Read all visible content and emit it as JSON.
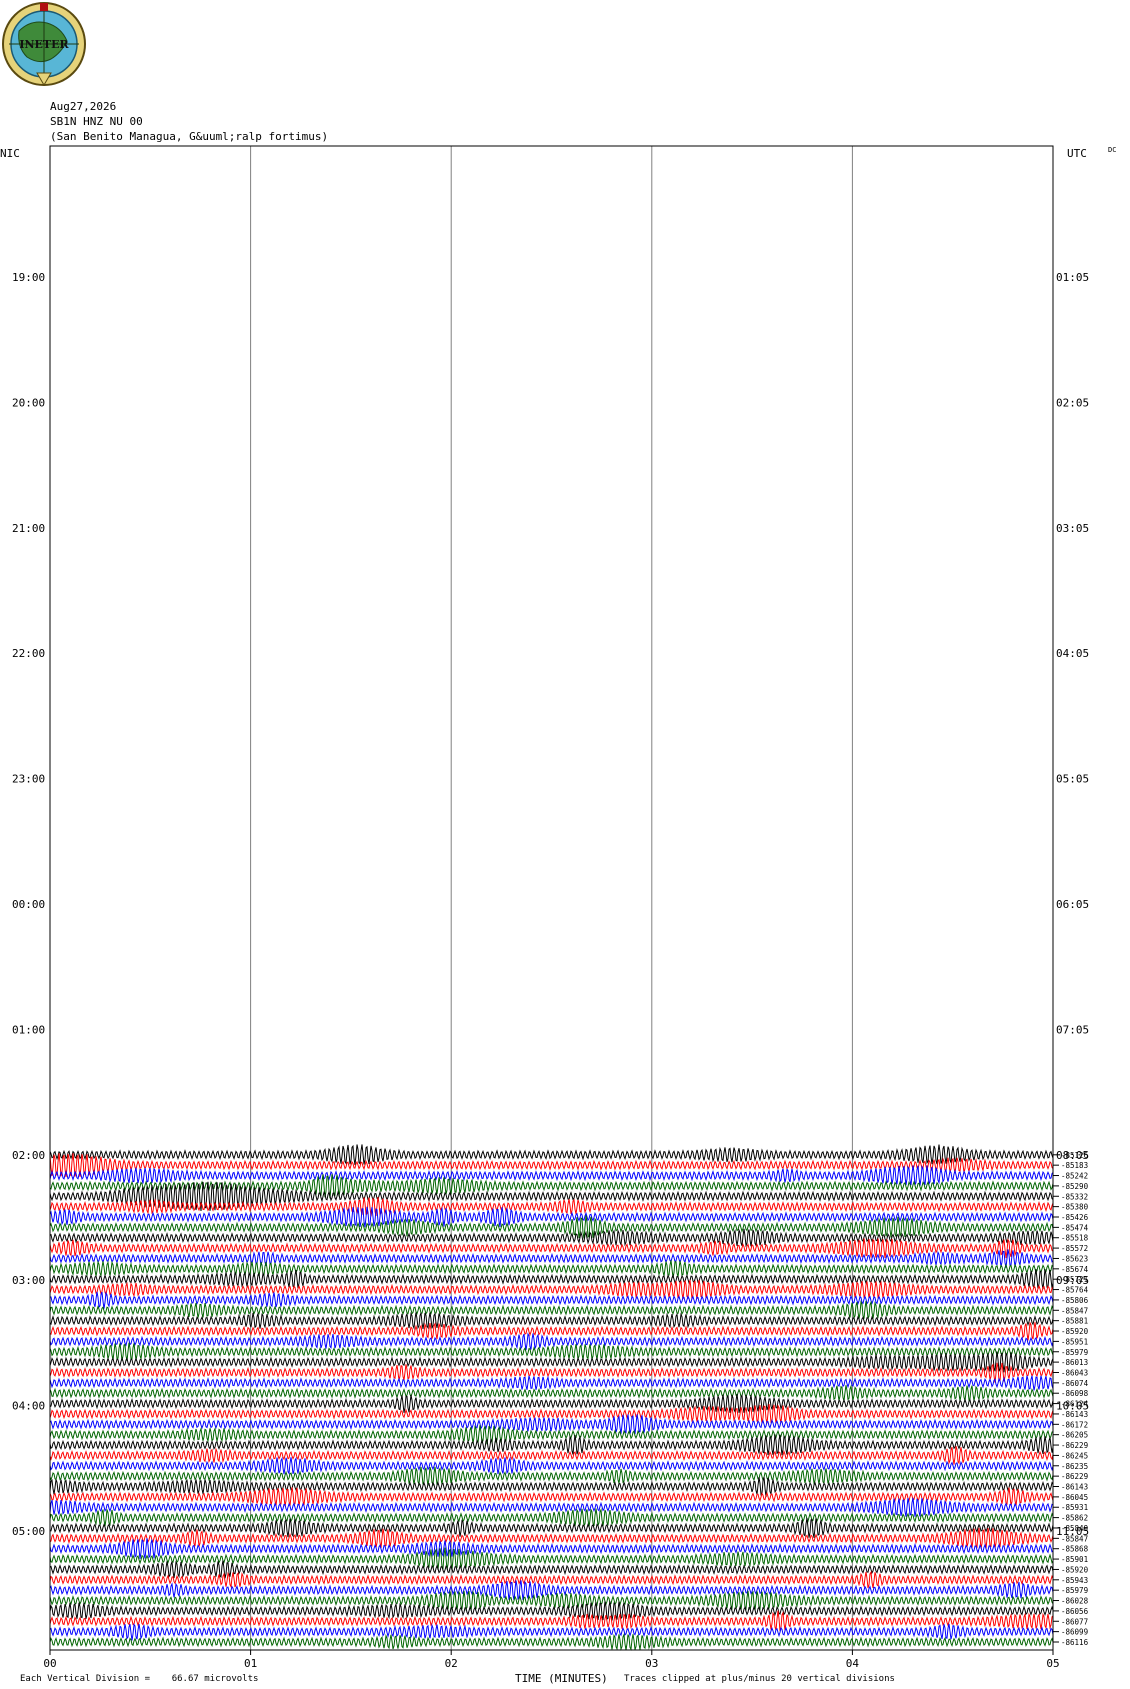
{
  "logo": {
    "text": "INETER"
  },
  "header": {
    "date": "Aug27,2026",
    "station": "SB1N HNZ NU 00",
    "location": "(San Benito Managua, G&uuml;ralp fortimus)"
  },
  "left_axis_title": "NIC",
  "right_axis_title": "UTC",
  "dc_label": "DC",
  "footer": {
    "scale": "Each Vertical Division =    66.67 microvolts",
    "xlabel": "TIME (MINUTES)",
    "clip_note": "Traces clipped at plus/minus 20 vertical divisions"
  },
  "colors": {
    "trace_cycle": [
      "#000000",
      "#ff0000",
      "#0000ff",
      "#006400"
    ],
    "grid": "#808080"
  },
  "chart_data": {
    "type": "line",
    "x_ticks": [
      "00",
      "01",
      "02",
      "03",
      "04",
      "05"
    ],
    "xlim": [
      0,
      5
    ],
    "left_time_labels": [
      "19:00",
      "20:00",
      "21:00",
      "22:00",
      "23:00",
      "00:00",
      "01:00",
      "02:00",
      "03:00",
      "04:00",
      "05:00"
    ],
    "right_time_labels": [
      "01:05",
      "02:05",
      "03:05",
      "04:05",
      "05:05",
      "06:05",
      "07:05",
      "08:05",
      "09:05",
      "10:05",
      "11:05"
    ],
    "trace_start_hour_index": 7,
    "trace_dc_offsets": [
      "-85126",
      "-85183",
      "-85242",
      "-85290",
      "-85332",
      "-85380",
      "-85426",
      "-85474",
      "-85518",
      "-85572",
      "-85623",
      "-85674",
      "-85721",
      "-85764",
      "-85806",
      "-85847",
      "-85881",
      "-85920",
      "-85951",
      "-85979",
      "-86013",
      "-86043",
      "-86074",
      "-86098",
      "-86124",
      "-86143",
      "-86172",
      "-86205",
      "-86229",
      "-86245",
      "-86235",
      "-86229",
      "-86143",
      "-86045",
      "-85931",
      "-85862",
      "-85849",
      "-85847",
      "-85868",
      "-85901",
      "-85920",
      "-85943",
      "-85979",
      "-86028",
      "-86056",
      "-86077",
      "-86099",
      "-86116"
    ]
  }
}
